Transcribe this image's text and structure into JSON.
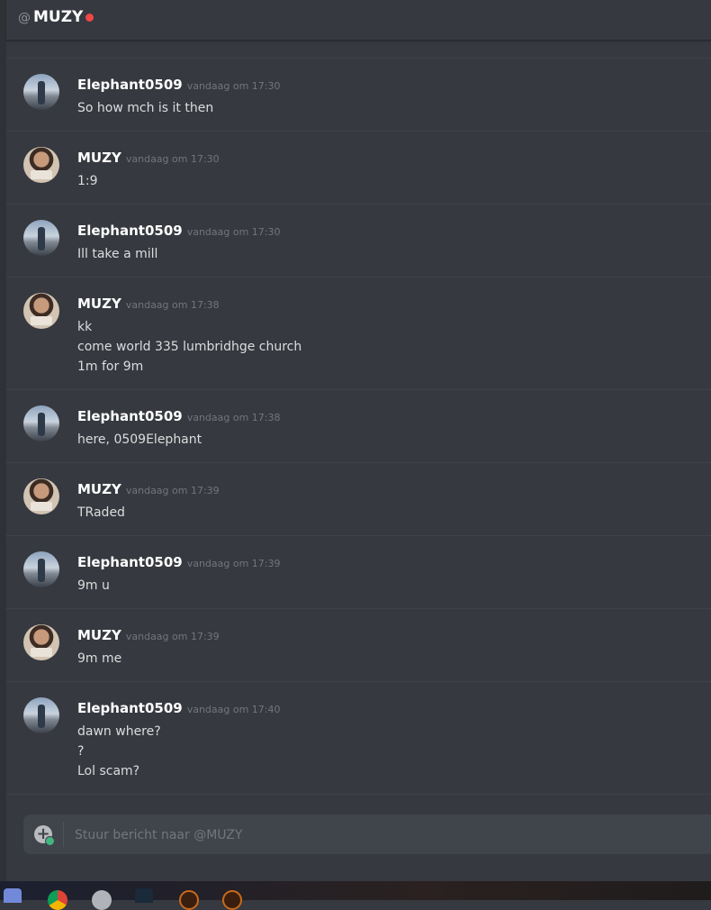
{
  "header": {
    "at_symbol": "@",
    "title": "MUZY",
    "status_color": "#f04747"
  },
  "messages": [
    {
      "author": "Elephant0509",
      "timestamp": "vandaag om 17:30",
      "lines": [
        "So how mch is it then"
      ]
    },
    {
      "author": "MUZY",
      "timestamp": "vandaag om 17:30",
      "lines": [
        "1:9"
      ]
    },
    {
      "author": "Elephant0509",
      "timestamp": "vandaag om 17:30",
      "lines": [
        "Ill take a mill"
      ]
    },
    {
      "author": "MUZY",
      "timestamp": "vandaag om 17:38",
      "lines": [
        "kk",
        "come world 335 lumbridhge church",
        "1m for 9m"
      ]
    },
    {
      "author": "Elephant0509",
      "timestamp": "vandaag om 17:38",
      "lines": [
        "here, 0509Elephant"
      ]
    },
    {
      "author": "MUZY",
      "timestamp": "vandaag om 17:39",
      "lines": [
        "TRaded"
      ]
    },
    {
      "author": "Elephant0509",
      "timestamp": "vandaag om 17:39",
      "lines": [
        "9m u"
      ]
    },
    {
      "author": "MUZY",
      "timestamp": "vandaag om 17:39",
      "lines": [
        "9m me"
      ]
    },
    {
      "author": "Elephant0509",
      "timestamp": "vandaag om 17:40",
      "lines": [
        "dawn where?",
        "?",
        "Lol scam?"
      ]
    }
  ],
  "composer": {
    "placeholder": "Stuur bericht naar @MUZY",
    "attach_icon": "plus-circle-icon"
  },
  "taskbar": {
    "icons": [
      "discord-icon",
      "chrome-icon",
      "owl-icon",
      "photoshop-icon",
      "dt-app-icon",
      "dt-app-icon"
    ]
  }
}
